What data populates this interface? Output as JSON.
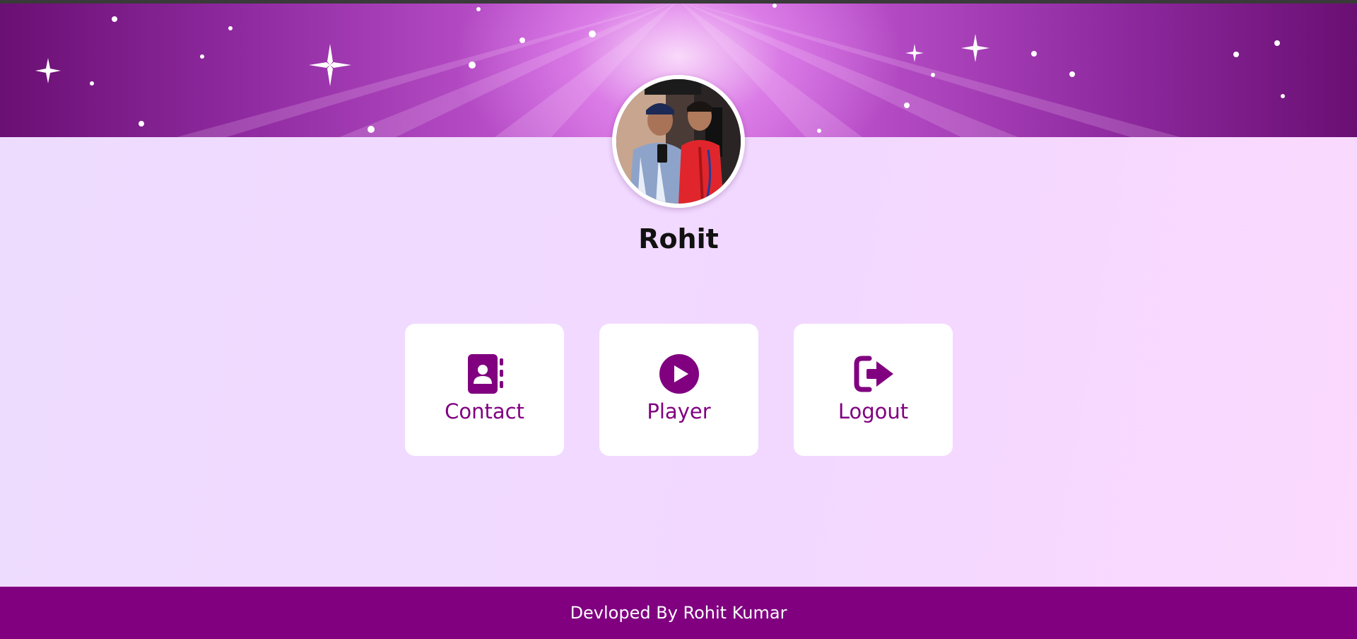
{
  "profile": {
    "name": "Rohit",
    "avatar_alt": "profile-photo"
  },
  "cards": [
    {
      "label": "Contact",
      "icon": "address-book-icon"
    },
    {
      "label": "Player",
      "icon": "play-circle-icon"
    },
    {
      "label": "Logout",
      "icon": "logout-icon"
    }
  ],
  "footer": {
    "text": "Devloped By Rohit Kumar"
  },
  "colors": {
    "accent": "#800080",
    "card_bg": "#ffffff",
    "banner_light": "#d777e2",
    "banner_dark": "#6a0f73"
  }
}
